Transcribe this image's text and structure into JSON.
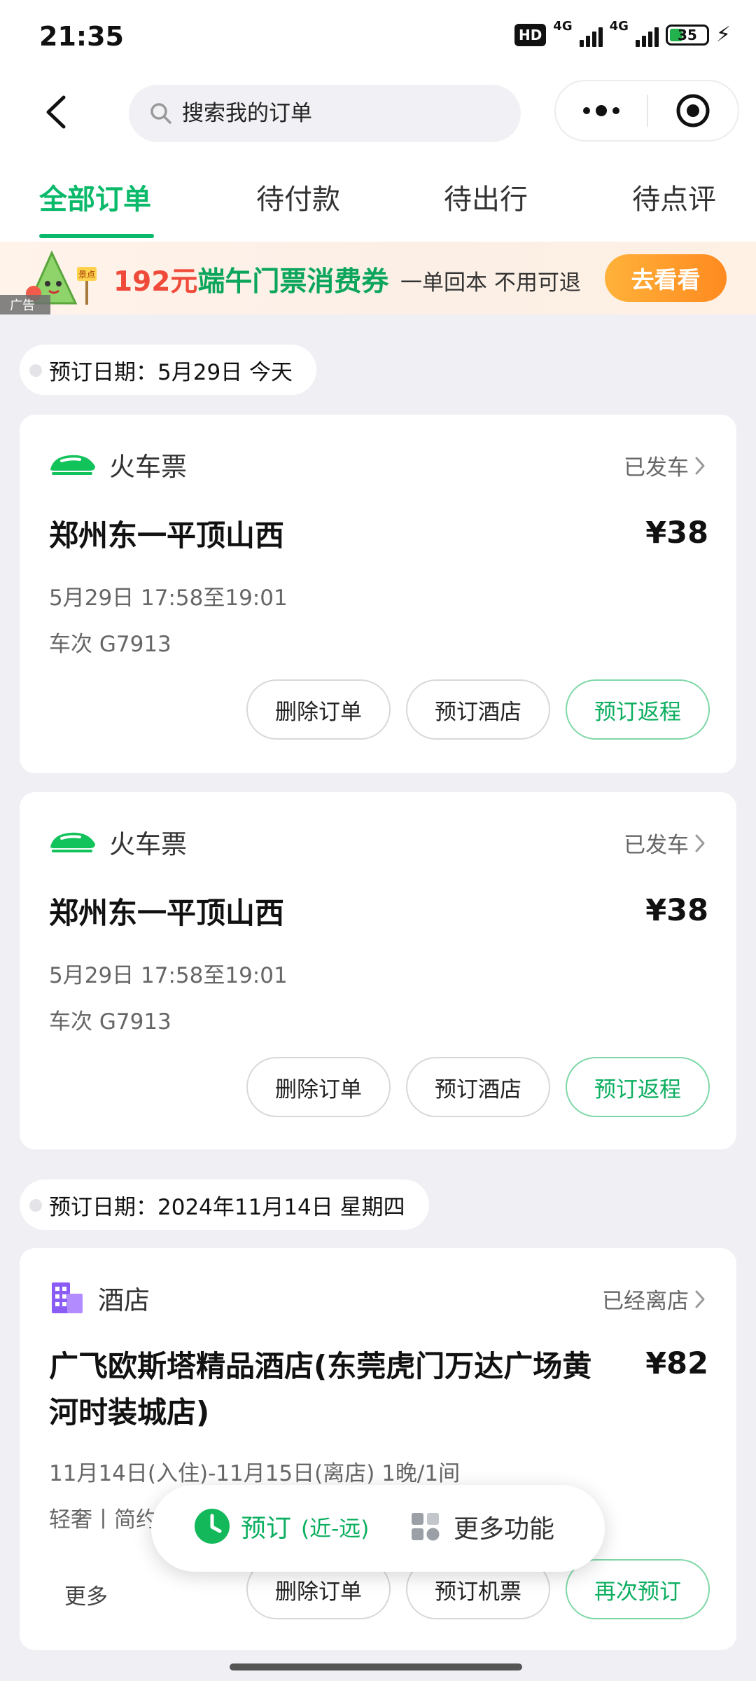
{
  "status_bar": {
    "time": "21:35",
    "hd": "HD",
    "net1": "4G",
    "net2": "4G",
    "battery": "35"
  },
  "header": {
    "search_placeholder": "搜索我的订单"
  },
  "tabs": [
    {
      "label": "全部订单",
      "active": true
    },
    {
      "label": "待付款",
      "active": false
    },
    {
      "label": "待出行",
      "active": false
    },
    {
      "label": "待点评",
      "active": false
    }
  ],
  "ad": {
    "amount": "192元",
    "title": "端午门票消费券",
    "subtitle": "一单回本 不用可退",
    "button": "去看看",
    "tag": "广告",
    "mascot_sign": "景点"
  },
  "groups": [
    {
      "date_label": "预订日期：5月29日 今天"
    },
    {
      "date_label": "预订日期：2024年11月14日 星期四"
    }
  ],
  "orders": [
    {
      "type": "火车票",
      "status": "已发车",
      "title": "郑州东一平顶山西",
      "price": "¥38",
      "line1": "5月29日 17:58至19:01",
      "line2": "车次 G7913",
      "buttons": [
        "删除订单",
        "预订酒店",
        "预订返程"
      ]
    },
    {
      "type": "火车票",
      "status": "已发车",
      "title": "郑州东一平顶山西",
      "price": "¥38",
      "line1": "5月29日 17:58至19:01",
      "line2": "车次 G7913",
      "buttons": [
        "删除订单",
        "预订酒店",
        "预订返程"
      ]
    },
    {
      "type": "酒店",
      "status": "已经离店",
      "title_line1": "广飞欧斯塔精品酒店(东莞虎门万达广场黄",
      "title_line2": "河时装城店)",
      "price": "¥82",
      "line1": "11月14日(入住)-11月15日(离店) 1晚/1间",
      "line2": "轻奢丨简约",
      "more": "更多",
      "buttons": [
        "删除订单",
        "预订机票",
        "再次预订"
      ]
    }
  ],
  "float_bar": {
    "book_label": "预订",
    "book_sub": "(近-远)",
    "more_label": "更多功能"
  },
  "colors": {
    "accent": "#0bb96a",
    "price_red": "#f04b3a",
    "ad_button": "#ff9a2a",
    "hotel_icon": "#8a5cf5"
  },
  "icons": [
    "back-arrow-icon",
    "search-icon",
    "more-dots-icon",
    "target-icon",
    "train-icon",
    "hotel-icon",
    "chevron-right-icon",
    "clock-icon",
    "grid-icon"
  ]
}
